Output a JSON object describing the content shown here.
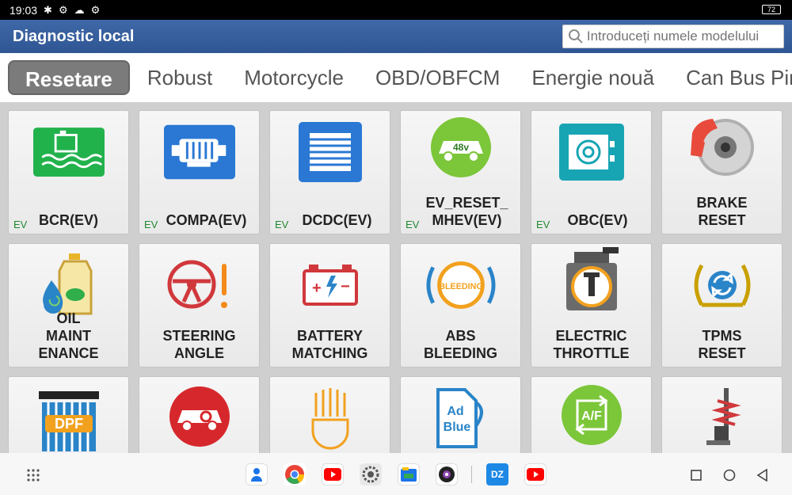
{
  "status": {
    "time": "19:03",
    "battery": "72"
  },
  "header": {
    "title": "Diagnostic local",
    "search_placeholder": "Introduceți numele modelului"
  },
  "tabs": [
    "Resetare",
    "Robust",
    "Motorcycle",
    "OBD/OBFCM",
    "Energie nouă",
    "Can Bus Pir"
  ],
  "active_tab": "Resetare",
  "tiles": [
    {
      "label": "BCR(EV)",
      "badge": "EV",
      "icon": "coolant-icon"
    },
    {
      "label": "COMPA(EV)",
      "badge": "EV",
      "icon": "compressor-icon"
    },
    {
      "label": "DCDC(EV)",
      "badge": "EV",
      "icon": "dcdc-icon"
    },
    {
      "label": "EV_RESET_ MHEV(EV)",
      "badge": "EV",
      "icon": "mhev-car-icon",
      "icon_text": "48v"
    },
    {
      "label": "OBC(EV)",
      "badge": "EV",
      "icon": "obc-icon"
    },
    {
      "label": "BRAKE RESET",
      "badge": "",
      "icon": "brake-disc-icon"
    },
    {
      "label": "OIL MAINT ENANCE",
      "badge": "",
      "icon": "oil-can-icon"
    },
    {
      "label": "STEERING ANGLE",
      "badge": "",
      "icon": "steering-wheel-icon"
    },
    {
      "label": "BATTERY MATCHING",
      "badge": "",
      "icon": "battery-icon"
    },
    {
      "label": "ABS BLEEDING",
      "badge": "",
      "icon": "abs-bleeding-icon",
      "icon_text": "BLEEDING"
    },
    {
      "label": "ELECTRIC THROTTLE",
      "badge": "",
      "icon": "throttle-icon"
    },
    {
      "label": "TPMS RESET",
      "badge": "",
      "icon": "tpms-icon"
    },
    {
      "label": "",
      "badge": "",
      "icon": "dpf-icon",
      "icon_text": "DPF"
    },
    {
      "label": "",
      "badge": "",
      "icon": "immobilizer-car-icon"
    },
    {
      "label": "",
      "badge": "",
      "icon": "headlamp-icon"
    },
    {
      "label": "",
      "badge": "",
      "icon": "adblue-icon",
      "icon_text": "Ad Blue"
    },
    {
      "label": "",
      "badge": "",
      "icon": "air-fuel-icon",
      "icon_text": "A/F"
    },
    {
      "label": "",
      "badge": "",
      "icon": "suspension-icon"
    }
  ],
  "dock": [
    {
      "name": "contacts-app-icon",
      "color": "#1a73e8"
    },
    {
      "name": "chrome-app-icon",
      "color": "#ea4335"
    },
    {
      "name": "youtube-app-icon",
      "color": "#ff0000"
    },
    {
      "name": "settings-app-icon",
      "color": "#666666"
    },
    {
      "name": "files-app-icon",
      "color": "#1a73e8"
    },
    {
      "name": "camera-app-icon",
      "color": "#222222"
    },
    {
      "name": "dz-app-icon",
      "color": "#1e88e5",
      "text": "DZ"
    },
    {
      "name": "youtube-app-icon-2",
      "color": "#ff0000"
    }
  ]
}
